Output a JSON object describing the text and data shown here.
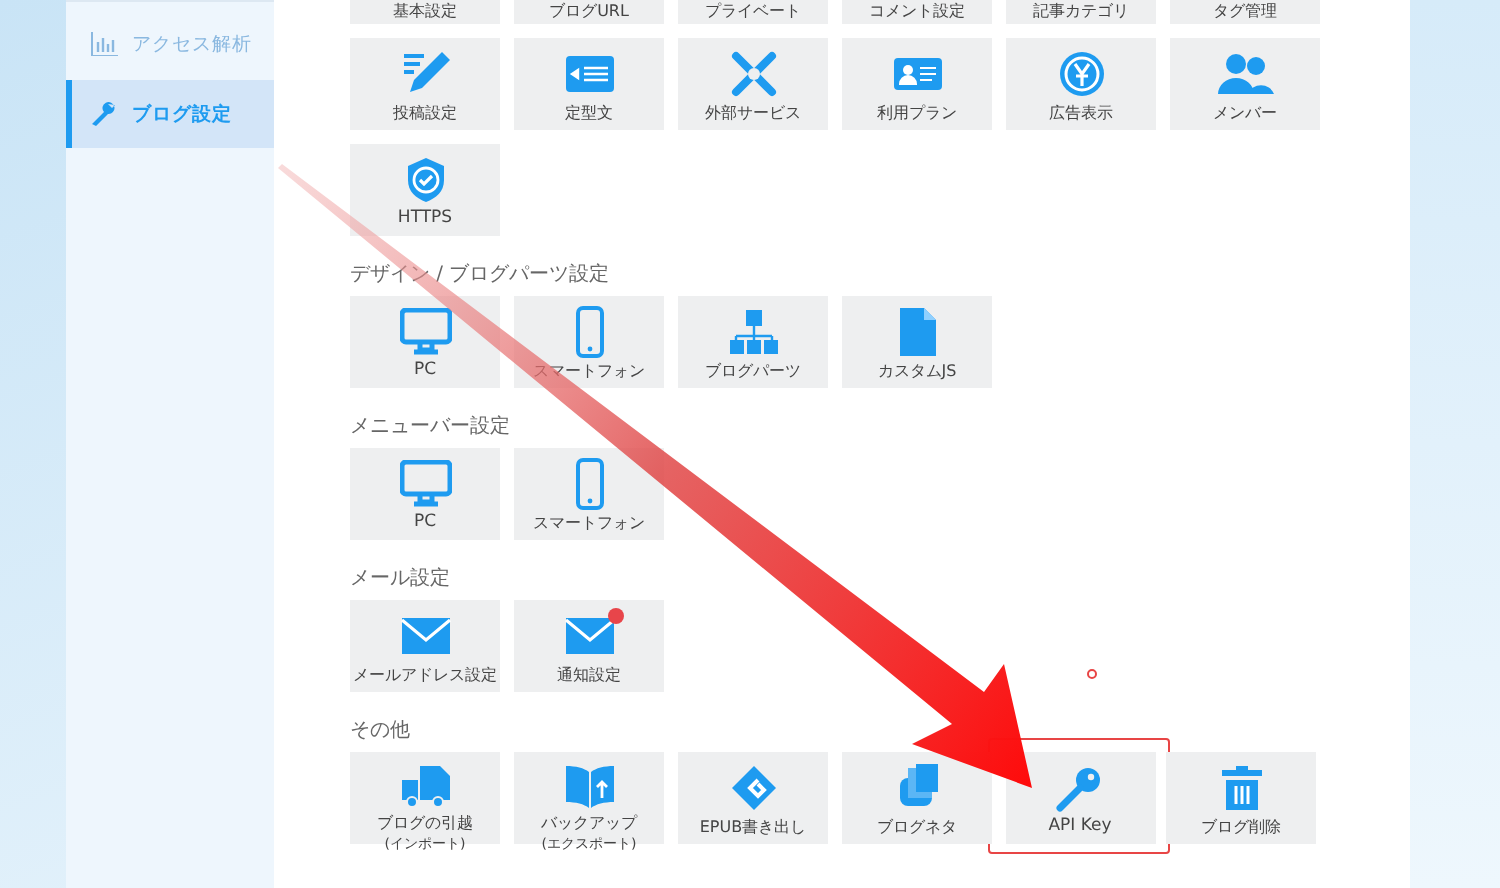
{
  "sidebar": {
    "items": [
      {
        "label": "アクセス解析",
        "selected": false
      },
      {
        "label": "ブログ設定",
        "selected": true
      }
    ]
  },
  "sections": [
    {
      "tiles": [
        {
          "kind": "partial",
          "label": "基本設定"
        },
        {
          "kind": "partial",
          "label": "ブログURL"
        },
        {
          "kind": "partial",
          "label": "プライベート"
        },
        {
          "kind": "partial",
          "label": "コメント設定"
        },
        {
          "kind": "partial",
          "label": "記事カテゴリ"
        },
        {
          "kind": "partial",
          "label": "タグ管理"
        },
        {
          "kind": "full",
          "label": "投稿設定"
        },
        {
          "kind": "full",
          "label": "定型文"
        },
        {
          "kind": "full",
          "label": "外部サービス"
        },
        {
          "kind": "full",
          "label": "利用プラン"
        },
        {
          "kind": "full",
          "label": "広告表示"
        },
        {
          "kind": "full",
          "label": "メンバー"
        },
        {
          "kind": "full",
          "label": "HTTPS"
        }
      ]
    },
    {
      "heading": "デザイン / ブログパーツ設定",
      "tiles": [
        {
          "kind": "full",
          "label": "PC"
        },
        {
          "kind": "full",
          "label": "スマートフォン"
        },
        {
          "kind": "full",
          "label": "ブログパーツ"
        },
        {
          "kind": "full",
          "label": "カスタムJS"
        }
      ]
    },
    {
      "heading": "メニューバー設定",
      "tiles": [
        {
          "kind": "full",
          "label": "PC"
        },
        {
          "kind": "full",
          "label": "スマートフォン"
        }
      ]
    },
    {
      "heading": "メール設定",
      "tiles": [
        {
          "kind": "full",
          "label": "メールアドレス設定",
          "notification": false
        },
        {
          "kind": "full",
          "label": "通知設定",
          "notification": true
        }
      ]
    },
    {
      "heading": "その他",
      "tiles": [
        {
          "kind": "full",
          "label": "ブログの引越",
          "sublabel": "(インポート)",
          "highlighted": false
        },
        {
          "kind": "full",
          "label": "バックアップ",
          "sublabel": "(エクスポート)",
          "highlighted": false
        },
        {
          "kind": "full",
          "label": "EPUB書き出し",
          "highlighted": false
        },
        {
          "kind": "full",
          "label": "ブログネタ",
          "highlighted": false
        },
        {
          "kind": "full",
          "label": "API Key",
          "highlighted": true
        },
        {
          "kind": "full",
          "label": "ブログ削除",
          "highlighted": false
        }
      ]
    }
  ]
}
